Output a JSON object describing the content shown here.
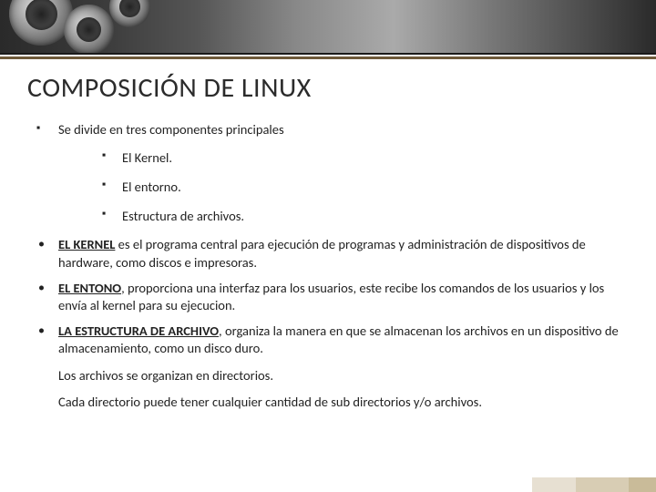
{
  "title": "COMPOSICIÓN DE LINUX",
  "intro": "Se divide en tres componentes principales",
  "components": {
    "0": "El Kernel.",
    "1": "El entorno.",
    "2": "Estructura de archivos."
  },
  "defs": {
    "kernel": {
      "term": "EL KERNEL",
      "rest": " es el programa central para ejecución de programas y administración de dispositivos de hardware, como discos e impresoras."
    },
    "entorno": {
      "term": "EL ENTONO",
      "rest": ", proporciona una interfaz para los usuarios, este recibe los comandos de los usuarios y los envía al kernel para su ejecucion."
    },
    "estructura": {
      "term": "LA ESTRUCTURA DE ARCHIVO",
      "rest": ", organiza la manera en que se almacenan los archivos en un dispositivo de almacenamiento, como un disco duro."
    }
  },
  "notes": {
    "0": "Los archivos se organizan en directorios.",
    "1": "Cada directorio puede tener cualquier cantidad de sub directorios y/o archivos."
  }
}
